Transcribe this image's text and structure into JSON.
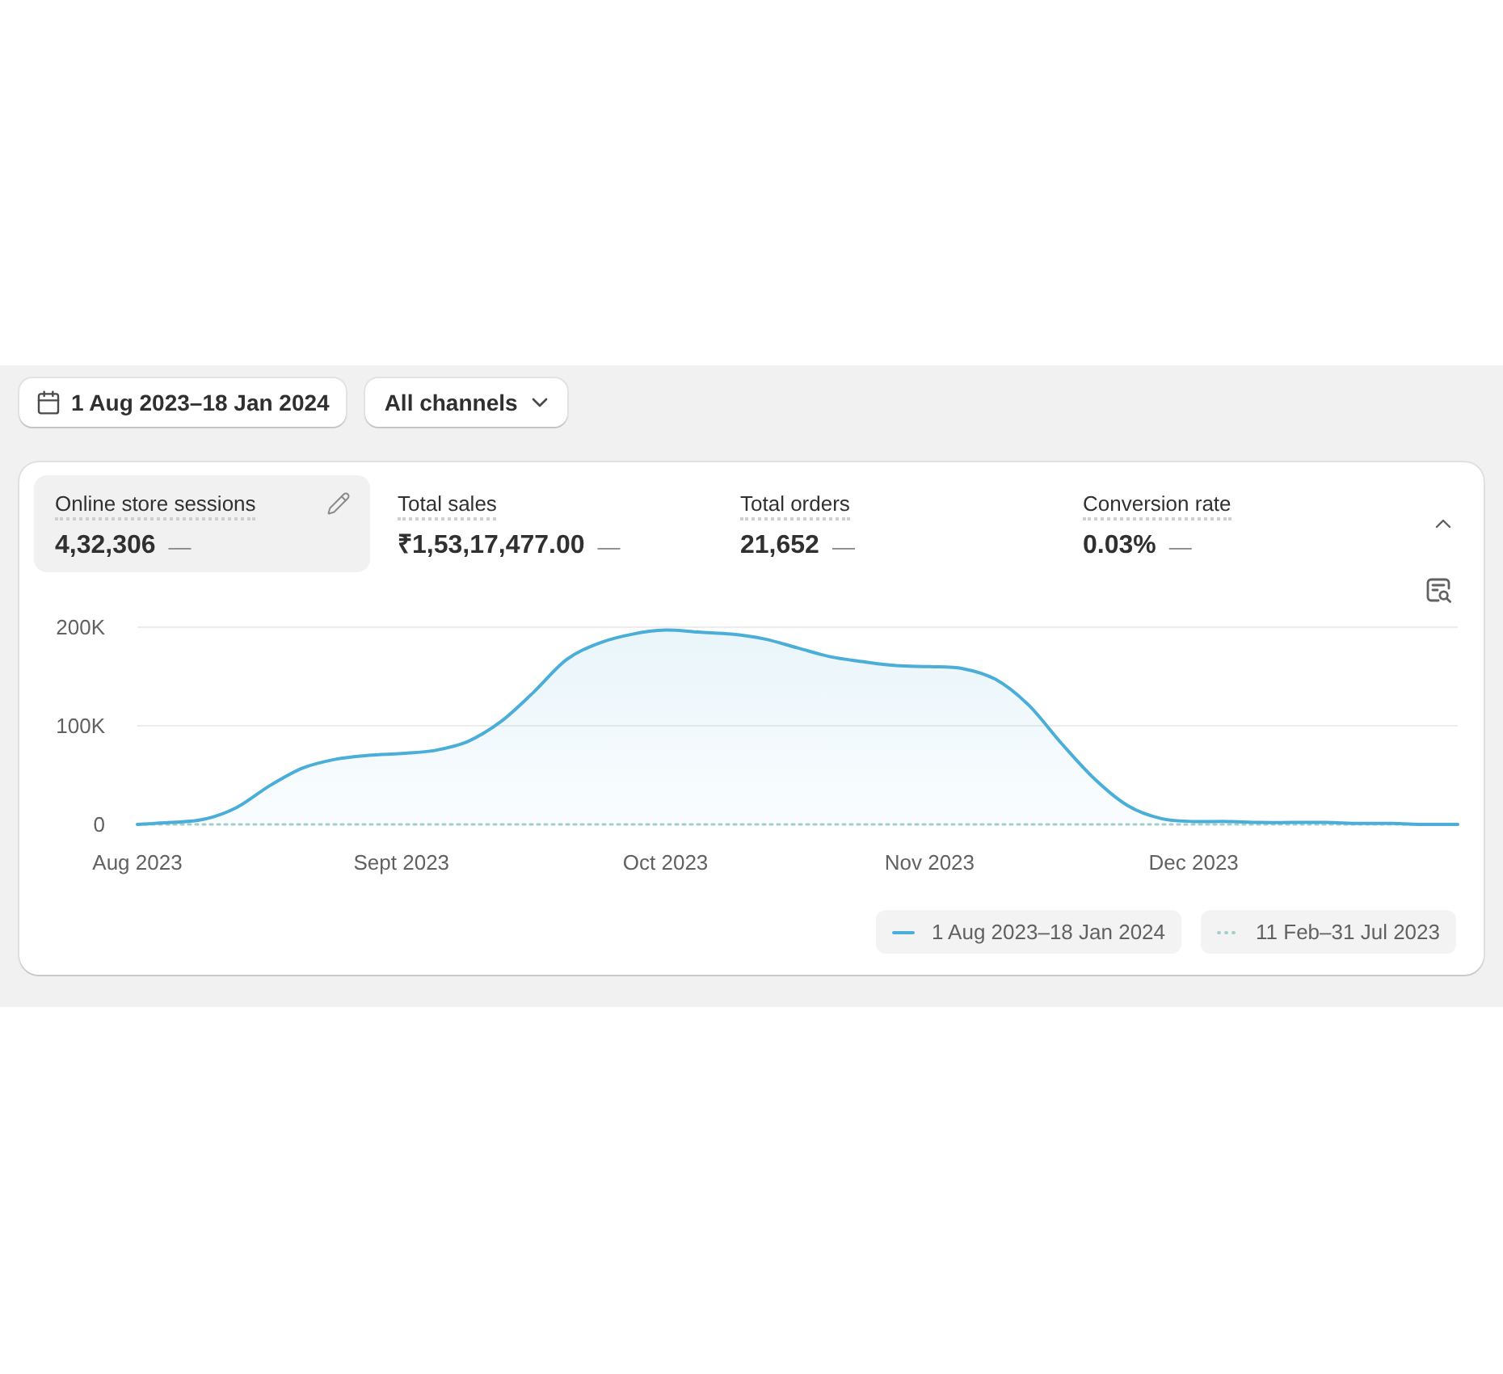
{
  "filters": {
    "date_range": "1 Aug 2023–18 Jan 2024",
    "channel": "All channels"
  },
  "summary_card": {
    "expanded": true,
    "metrics": [
      {
        "label": "Online store sessions",
        "value": "4,32,306",
        "comparison": "—",
        "selected": true
      },
      {
        "label": "Total sales",
        "value": "₹1,53,17,477.00",
        "comparison": "—",
        "selected": false
      },
      {
        "label": "Total orders",
        "value": "21,652",
        "comparison": "—",
        "selected": false
      },
      {
        "label": "Conversion rate",
        "value": "0.03%",
        "comparison": "—",
        "selected": false
      }
    ],
    "chart_data": {
      "type": "area",
      "categories": [
        "Aug 2023",
        null,
        null,
        null,
        null,
        null,
        null,
        null,
        "Sept 2023",
        null,
        null,
        null,
        null,
        null,
        null,
        null,
        "Oct 2023",
        null,
        null,
        null,
        null,
        null,
        null,
        null,
        "Nov 2023",
        null,
        null,
        null,
        null,
        null,
        null,
        null,
        "Dec 2023",
        null,
        null,
        null,
        null,
        null,
        null,
        null,
        null
      ],
      "ylim": [
        0,
        200000
      ],
      "yticks": [
        {
          "value": 0,
          "label": "0"
        },
        {
          "value": 100000,
          "label": "100K"
        },
        {
          "value": 200000,
          "label": "200K"
        }
      ],
      "series": [
        {
          "name": "1 Aug 2023–18 Jan 2024",
          "color": "#4aaed9",
          "line_style": "solid",
          "values": [
            0,
            2000,
            5000,
            17000,
            39000,
            57000,
            66000,
            70000,
            72000,
            75000,
            84000,
            104000,
            134000,
            167000,
            184000,
            193000,
            197000,
            195000,
            193000,
            188000,
            179000,
            170000,
            165000,
            161000,
            160000,
            158000,
            147000,
            121000,
            82000,
            46000,
            19000,
            6000,
            3000,
            3000,
            2000,
            2000,
            2000,
            1000,
            1000,
            0,
            0
          ]
        },
        {
          "name": "11 Feb–31 Jul 2023",
          "type": "line",
          "color": "#a3cfc9",
          "line_style": "dotted",
          "values": [
            0,
            0,
            0,
            0,
            0,
            0,
            0,
            0,
            0,
            0,
            0,
            0,
            0,
            0,
            0,
            0,
            0,
            0,
            0,
            0,
            0,
            0,
            0,
            0,
            0,
            0,
            0,
            0,
            0,
            0,
            0,
            0,
            0,
            0,
            0,
            0,
            0,
            0,
            0,
            0,
            0
          ]
        }
      ]
    }
  }
}
